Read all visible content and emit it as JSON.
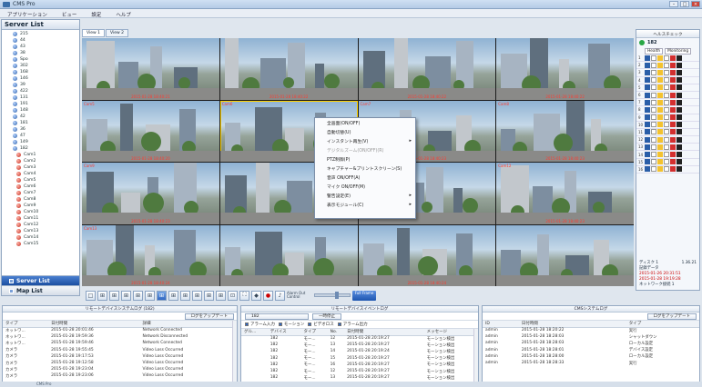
{
  "window": {
    "title": "CMS Pro"
  },
  "menu": [
    "アプリケーション",
    "ビュー",
    "設定",
    "ヘルプ"
  ],
  "server_list": {
    "title": "Server List",
    "servers": [
      "215",
      "44",
      "43",
      "38",
      "Spo",
      "302",
      "168",
      "146",
      "39",
      "422",
      "131",
      "191",
      "148",
      "42",
      "181",
      "36",
      "47",
      "149"
    ],
    "expanded_server": "182",
    "cameras": [
      "Cam1",
      "Cam2",
      "Cam3",
      "Cam4",
      "Cam5",
      "Cam6",
      "Cam7",
      "Cam8",
      "Cam9",
      "Cam10",
      "Cam11",
      "Cam12",
      "Cam13",
      "Cam14",
      "Cam15"
    ]
  },
  "left_tabs": {
    "server": "Server List",
    "map": "Map List"
  },
  "view_tabs": [
    "View 1",
    "View 2"
  ],
  "grid": {
    "tiles": [
      {
        "label": "",
        "ts": "2015-01-28 18:40:21"
      },
      {
        "label": "",
        "ts": "2015-01-28 18:40:22"
      },
      {
        "label": "",
        "ts": "2015-01-28 18:40:22"
      },
      {
        "label": "",
        "ts": "2015-01-28 18:40:22"
      },
      {
        "label": "Cam5",
        "ts": "2015-01-28 18:40:20"
      },
      {
        "label": "Cam6",
        "ts": ""
      },
      {
        "label": "Cam7",
        "ts": "2015-01-28 18:40:23"
      },
      {
        "label": "Cam8",
        "ts": "2015-01-28 18:40:23"
      },
      {
        "label": "Cam9",
        "ts": "2015-01-28 18:40:23"
      },
      {
        "label": "",
        "ts": ""
      },
      {
        "label": "",
        "ts": ""
      },
      {
        "label": "Cam12",
        "ts": "2015-01-28 18:40:23"
      },
      {
        "label": "Cam13",
        "ts": "2015-01-28 18:40:24"
      },
      {
        "label": "",
        "ts": ""
      },
      {
        "label": "",
        "ts": "2015-01-28 18:40:24"
      },
      {
        "label": "",
        "ts": ""
      }
    ]
  },
  "context_menu": [
    {
      "label": "全画面(ON/OFF)",
      "disabled": false,
      "sub": false
    },
    {
      "label": "自動切替(U)",
      "disabled": false,
      "sub": false
    },
    {
      "label": "インスタント再生(V)",
      "disabled": false,
      "sub": true
    },
    {
      "label": "デジタルズーム(ON/OFF)(R)",
      "disabled": true,
      "sub": false
    },
    {
      "label": "PTZ制御(P)",
      "disabled": false,
      "sub": false
    },
    {
      "label": "キャプチャー&プリントスクリーン(S)",
      "disabled": false,
      "sub": false
    },
    {
      "label": "音声 ON/OFF(A)",
      "disabled": false,
      "sub": false
    },
    {
      "label": "マイク ON/OFF(M)",
      "disabled": false,
      "sub": false
    },
    {
      "label": "警告設定(E)",
      "disabled": false,
      "sub": true
    },
    {
      "label": "表示モジュール(C)",
      "disabled": false,
      "sub": true
    }
  ],
  "health": {
    "title": "ヘルスチェック",
    "device": "182",
    "cols": [
      "Health",
      "Monitoring"
    ],
    "rows": [
      [
        "1",
        "ok",
        "w",
        "y",
        "w",
        "r",
        "k"
      ],
      [
        "2",
        "ok",
        "w",
        "y",
        "w",
        "r",
        "k"
      ],
      [
        "3",
        "ok",
        "w",
        "y",
        "w",
        "r",
        "k"
      ],
      [
        "4",
        "ok",
        "w",
        "y",
        "w",
        "r",
        "k"
      ],
      [
        "5",
        "ok",
        "w",
        "y",
        "w",
        "r",
        "k"
      ],
      [
        "6",
        "ok",
        "w",
        "y",
        "w",
        "r",
        "k"
      ],
      [
        "7",
        "ok",
        "w",
        "y",
        "w",
        "r",
        "k"
      ],
      [
        "8",
        "ok",
        "w",
        "y",
        "w",
        "r",
        "k"
      ],
      [
        "9",
        "ok",
        "w",
        "y",
        "w",
        "r",
        "k"
      ],
      [
        "10",
        "ok",
        "w",
        "y",
        "w",
        "r",
        "k"
      ],
      [
        "11",
        "ok",
        "w",
        "y",
        "w",
        "r",
        "k"
      ],
      [
        "12",
        "ok",
        "w",
        "y",
        "w",
        "r",
        "k"
      ],
      [
        "13",
        "ok",
        "w",
        "y",
        "w",
        "r",
        "k"
      ],
      [
        "14",
        "ok",
        "w",
        "y",
        "w",
        "r",
        "k"
      ],
      [
        "15",
        "ok",
        "w",
        "y",
        "w",
        "r",
        "k"
      ],
      [
        "16",
        "ok",
        "w",
        "y",
        "w",
        "r",
        "k"
      ]
    ],
    "disk_label": "ディスク 1",
    "disk_pct": "1.36.21",
    "record_title": "記録データ",
    "record_from": "2015-01-26 20:31:51",
    "record_to": "2015-01-28 19:19:28",
    "network": "ネットワーク接続 1"
  },
  "toolbar": {
    "alarm_label": "Alarm Out Control",
    "full_label": "Full Frame"
  },
  "remote_log": {
    "title": "リモートデバイスシステムログ (182)",
    "button": "ログをアップデート",
    "columns": [
      "タイプ",
      "日付時間",
      "詳細"
    ],
    "rows": [
      [
        "ネットワ...",
        "2015-01-28 20:01:46",
        "Network Connected"
      ],
      [
        "ネットワ...",
        "2015-01-28 19:59:36",
        "Network Disconnected"
      ],
      [
        "ネットワ...",
        "2015-01-28 19:59:46",
        "Network Connected"
      ],
      [
        "カメラ",
        "2015-01-28 19:55:45",
        "Video Loss Occurred"
      ],
      [
        "カメラ",
        "2015-01-28 19:17:53",
        "Video Loss Occurred"
      ],
      [
        "カメラ",
        "2015-01-28 19:12:58",
        "Video Loss Occurred"
      ],
      [
        "カメラ",
        "2015-01-28 19:23:04",
        "Video Loss Occurred"
      ],
      [
        "カメラ",
        "2015-01-28 19:23:06",
        "Video Loss Occurred"
      ]
    ]
  },
  "event_log": {
    "title": "リモートデバイスイベントログ",
    "device": "182",
    "filter": "一時停止",
    "checks": [
      "アラーム入力",
      "モーション",
      "ビデオロス",
      "アラーム出力"
    ],
    "columns": [
      "グル...",
      "デバイス",
      "タイプ",
      "No.",
      "日付時間",
      "メッセージ"
    ],
    "rows": [
      [
        "",
        "182",
        "モー...",
        "12",
        "2015-01-28 20:19:27",
        "モーション検出"
      ],
      [
        "",
        "182",
        "モー...",
        "13",
        "2015-01-28 20:19:27",
        "モーション検出"
      ],
      [
        "",
        "182",
        "モー...",
        "14",
        "2015-01-28 20:19:24",
        "モーション検出"
      ],
      [
        "",
        "182",
        "モー...",
        "15",
        "2015-01-28 20:19:27",
        "モーション検出"
      ],
      [
        "",
        "182",
        "モー...",
        "16",
        "2015-01-28 20:19:27",
        "モーション検出"
      ],
      [
        "",
        "182",
        "モー...",
        "12",
        "2015-01-28 20:19:27",
        "モーション検出"
      ],
      [
        "",
        "182",
        "モー...",
        "13",
        "2015-01-28 20:19:27",
        "モーション検出"
      ]
    ]
  },
  "cms_log": {
    "title": "CMSシステムログ",
    "button": "ログをアップデート",
    "columns": [
      "ID",
      "日付時間",
      "タイプ"
    ],
    "rows": [
      [
        "admin",
        "2015-01-28 18:20:22",
        "実行"
      ],
      [
        "admin",
        "2015-01-28 18:28:03",
        "シャットダウン"
      ],
      [
        "admin",
        "2015-01-28 18:28:03",
        "ローカル設定"
      ],
      [
        "admin",
        "2015-01-28 18:28:01",
        "デバイス設定"
      ],
      [
        "admin",
        "2015-01-28 18:28:00",
        "ローカル設定"
      ],
      [
        "admin",
        "2015-01-28 18:28:33",
        "実行"
      ]
    ]
  },
  "status": "CMS Pro"
}
